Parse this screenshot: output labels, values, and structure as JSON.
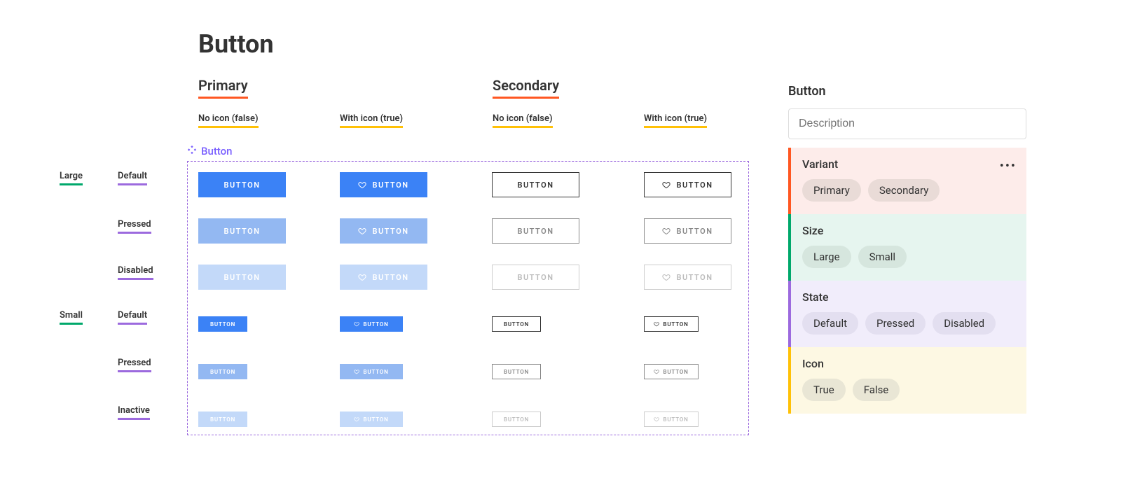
{
  "title": "Button",
  "sections": {
    "primary": "Primary",
    "secondary": "Secondary"
  },
  "columns": {
    "noIcon": "No icon (false)",
    "withIcon": "With icon (true)"
  },
  "sizes": {
    "large": "Large",
    "small": "Small"
  },
  "states": {
    "default": "Default",
    "pressed": "Pressed",
    "disabled": "Disabled",
    "inactive": "Inactive"
  },
  "componentLabel": "Button",
  "buttonLabel": "BUTTON",
  "panel": {
    "title": "Button",
    "descriptionPlaceholder": "Description",
    "props": {
      "variant": {
        "name": "Variant",
        "options": [
          "Primary",
          "Secondary"
        ]
      },
      "size": {
        "name": "Size",
        "options": [
          "Large",
          "Small"
        ]
      },
      "state": {
        "name": "State",
        "options": [
          "Default",
          "Pressed",
          "Disabled"
        ]
      },
      "icon": {
        "name": "Icon",
        "options": [
          "True",
          "False"
        ]
      }
    }
  }
}
